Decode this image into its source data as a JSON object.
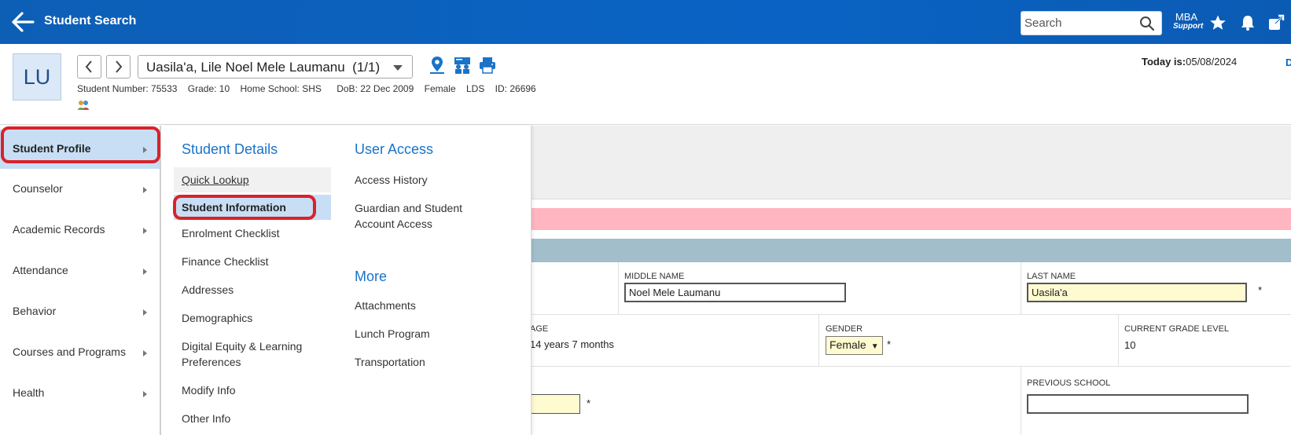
{
  "topbar": {
    "title": "Student Search",
    "search_placeholder": "Search",
    "support_line1": "MBA",
    "support_line2": "Support"
  },
  "student": {
    "initials": "LU",
    "selector_label": "Uasila'a, Lile Noel Mele Laumanu  (1/1)",
    "meta": {
      "student_number": "Student Number: 75533",
      "grade": "Grade: 10",
      "home_school": "Home School: SHS",
      "dob": "DoB: 22 Dec 2009",
      "gender": "Female",
      "lds": "LDS",
      "id": "ID: 26696"
    },
    "today_label": "Today is:",
    "today_date": "05/08/2024",
    "right_cut": "D"
  },
  "leftnav": {
    "items": [
      {
        "label": "Student Profile"
      },
      {
        "label": "Counselor"
      },
      {
        "label": "Academic Records"
      },
      {
        "label": "Attendance"
      },
      {
        "label": "Behavior"
      },
      {
        "label": "Courses and Programs"
      },
      {
        "label": "Health"
      }
    ]
  },
  "flyout": {
    "col1_heading": "Student Details",
    "col1_items": [
      {
        "label": "Quick Lookup"
      },
      {
        "label": "Student Information"
      },
      {
        "label": "Enrolment Checklist"
      },
      {
        "label": "Finance Checklist"
      },
      {
        "label": "Addresses"
      },
      {
        "label": "Demographics"
      },
      {
        "label": "Digital Equity & Learning Preferences"
      },
      {
        "label": "Modify Info"
      },
      {
        "label": "Other Info"
      }
    ],
    "col2_heading": "User Access",
    "col2_items": [
      {
        "label": "Access History"
      },
      {
        "label": "Guardian and Student Account Access"
      }
    ],
    "col3_heading": "More",
    "col3_items": [
      {
        "label": "Attachments"
      },
      {
        "label": "Lunch Program"
      },
      {
        "label": "Transportation"
      }
    ]
  },
  "form": {
    "middle_name_label": "MIDDLE NAME",
    "middle_name_value": "Noel Mele Laumanu",
    "last_name_label": "LAST NAME",
    "last_name_value": "Uasila'a",
    "age_label": "AGE",
    "age_value": "14 years 7 months",
    "gender_label": "GENDER",
    "gender_value": "Female",
    "grade_label": "CURRENT GRADE LEVEL",
    "grade_value": "10",
    "previous_school_label": "PREVIOUS SCHOOL",
    "previous_school_value": "",
    "required_mark": "*"
  },
  "colors": {
    "topbar": "#0a63c4",
    "accent": "#1a73c9",
    "highlight_ring": "#d8232a",
    "active_nav": "#c7def5",
    "pink_band": "#ffb6c1",
    "blue_band": "#a3becb",
    "required_field": "#fffbd1"
  }
}
